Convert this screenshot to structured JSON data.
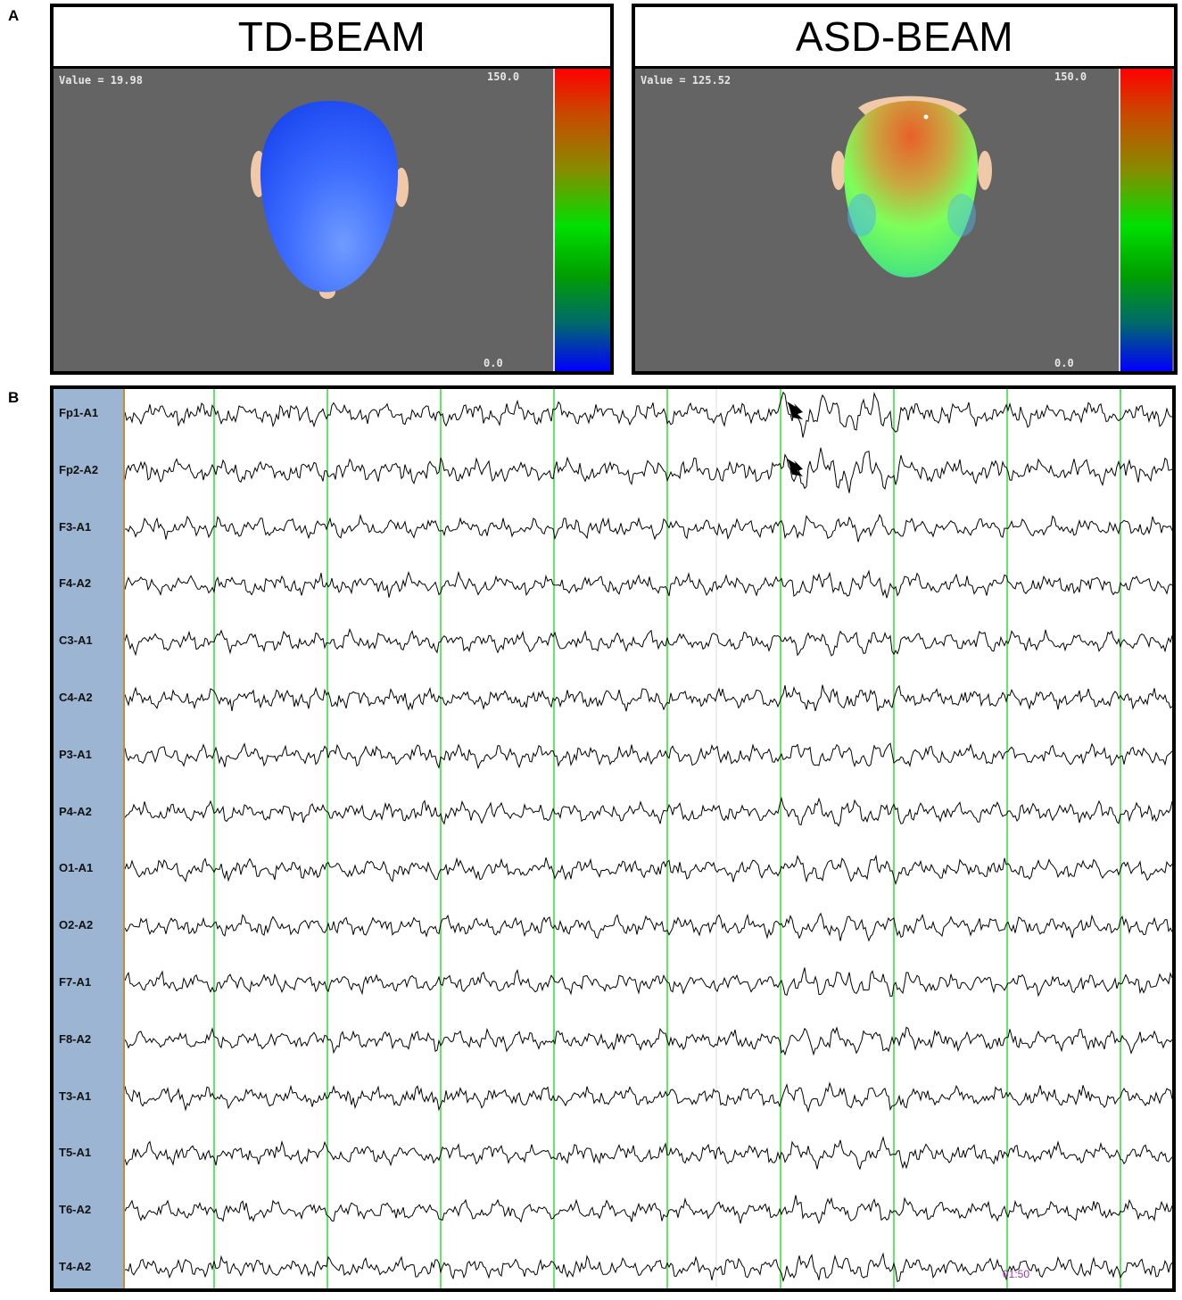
{
  "panel_a": {
    "letter": "A",
    "left": {
      "title": "TD-BEAM",
      "value_text": "Value = 19.98",
      "scale_max": "150.0",
      "scale_min": "0.0",
      "head_color": "#2f63ff"
    },
    "right": {
      "title": "ASD-BEAM",
      "value_text": "Value = 125.52",
      "scale_max": "150.0",
      "scale_min": "0.0"
    },
    "colorbar_colors": [
      "#ff0000",
      "#8a8a00",
      "#00e000",
      "#006a6a",
      "#0000ff"
    ]
  },
  "panel_b": {
    "letter": "B",
    "channels": [
      "Fp1-A1",
      "Fp2-A2",
      "F3-A1",
      "F4-A2",
      "C3-A1",
      "C4-A2",
      "P3-A1",
      "P4-A2",
      "O1-A1",
      "O2-A2",
      "F7-A1",
      "F8-A2",
      "T3-A1",
      "T5-A1",
      "T6-A2",
      "T4-A2"
    ],
    "timestamp": "01:50",
    "marker_line_color": "#33dd33",
    "trace_color": "#000000",
    "label_bg_color": "#9cb5d3"
  }
}
